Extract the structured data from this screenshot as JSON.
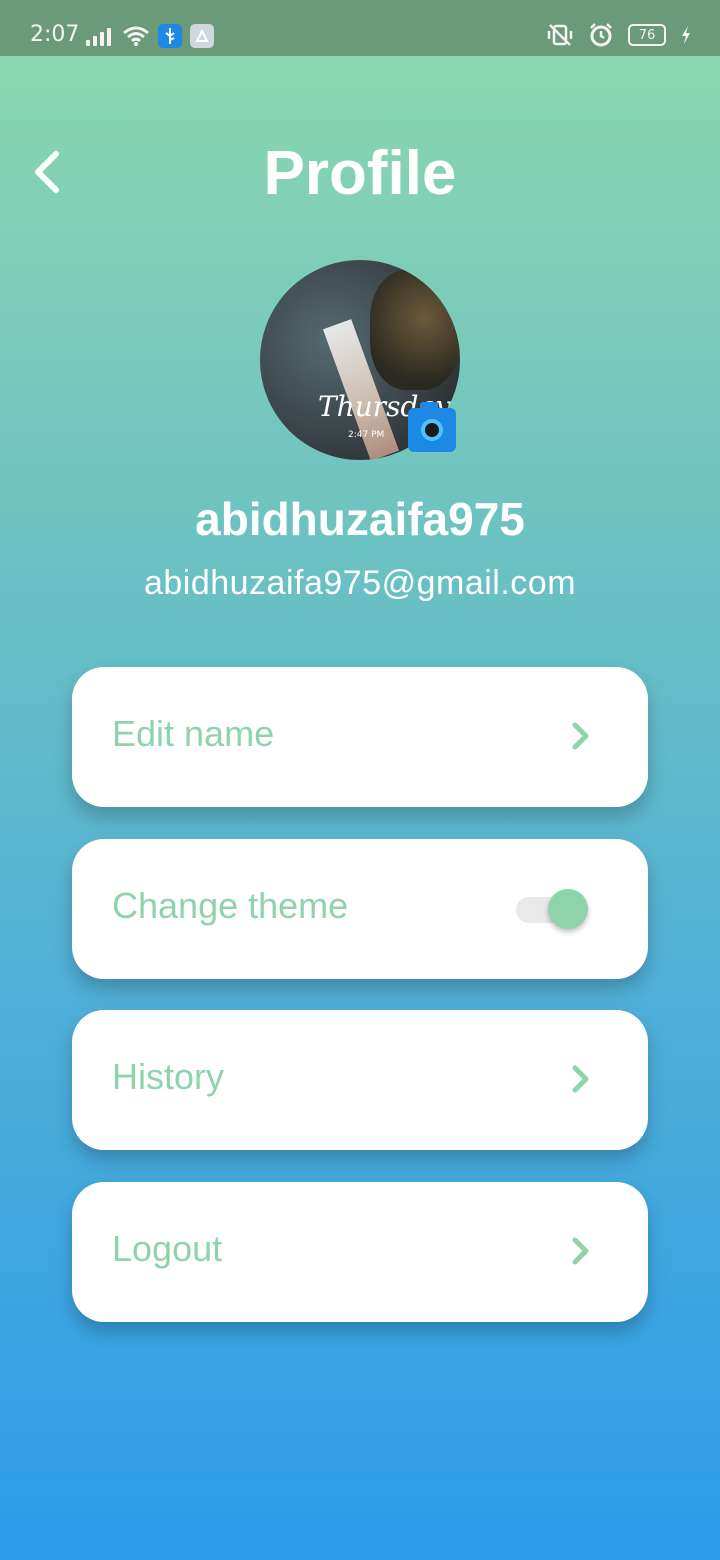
{
  "status_bar": {
    "time": "2:07",
    "battery": "76"
  },
  "header": {
    "title": "Profile"
  },
  "profile": {
    "username": "abidhuzaifa975",
    "email": "abidhuzaifa975@gmail.com",
    "avatar_overlay_text": "Thursday",
    "avatar_overlay_time": "2:47 PM"
  },
  "menu": {
    "items": [
      {
        "label": "Edit name",
        "control": "chevron"
      },
      {
        "label": "Change theme",
        "control": "toggle",
        "toggle_on": true
      },
      {
        "label": "History",
        "control": "chevron"
      },
      {
        "label": "Logout",
        "control": "chevron"
      }
    ]
  },
  "colors": {
    "accent_green": "#8fd3ab",
    "status_bar_bg": "#6a9a7a",
    "gradient_top": "#8ed8ae",
    "gradient_bottom": "#2b9bea",
    "camera_blue": "#1e88e5"
  },
  "icons": {
    "back": "chevron-left-icon",
    "camera": "camera-icon",
    "chevron": "chevron-right-icon",
    "status": [
      "signal-icon",
      "wifi-icon",
      "usb-icon",
      "hub-icon",
      "vibrate-off-icon",
      "alarm-icon",
      "battery-icon",
      "charging-icon"
    ]
  }
}
